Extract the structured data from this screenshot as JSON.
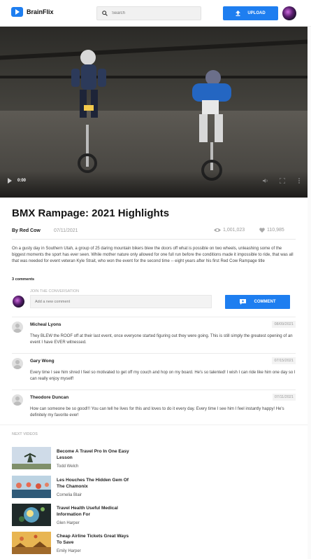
{
  "header": {
    "logo_text": "BrainFlix",
    "search_placeholder": "Search",
    "upload_label": "UPLOAD"
  },
  "video": {
    "time": "0:00",
    "title": "BMX Rampage: 2021 Highlights",
    "channel": "By Red Cow",
    "date": "07/11/2021",
    "views": "1,001,023",
    "likes": "110,985",
    "description": "On a gusty day in Southern Utah, a group of 25 daring mountain bikers blew the doors off what is possible on two wheels, unleashing some of the biggest moments the sport has ever seen. While mother nature only allowed for one full run before the conditions made it impossible to ride, that was all that was needed for event veteran Kyle Strait, who won the event for the second time -- eight years after his first Red Cow Rampage title"
  },
  "comments_section": {
    "count": "3 comments",
    "join_label": "JOIN THE CONVERSATION",
    "input_placeholder": "Add a new comment",
    "button_label": "COMMENT",
    "comments": [
      {
        "name": "Micheal Lyons",
        "date": "08/09/2021",
        "text": "They BLEW the ROOF off at their last event, once everyone started figuring out they were going. This is still simply the greatest opening of an event I have EVER witnessed."
      },
      {
        "name": "Gary Wong",
        "date": "07/15/2021",
        "text": "Every time I see him shred I feel so motivated to get off my couch and hop on my board. He's so talented! I wish I can ride like him one day so I can really enjoy myself!"
      },
      {
        "name": "Theodore Duncan",
        "date": "07/11/2021",
        "text": "How can someone be so good!!! You can tell he lives for this and loves to do it every day. Every time I see him I feel instantly happy! He's definitely my favorite ever!"
      }
    ]
  },
  "next_videos": {
    "heading": "NEXT VIDEOS",
    "items": [
      {
        "title": "Become A Travel Pro In One Easy Lesson",
        "author": "Todd Welch"
      },
      {
        "title": "Les Houches The Hidden Gem Of The Chamonix",
        "author": "Cornelia Blair"
      },
      {
        "title": "Travel Health Useful Medical Information For",
        "author": "Glen Harper"
      },
      {
        "title": "Cheap Airline Tickets Great Ways To Save",
        "author": "Emily Harper"
      }
    ]
  },
  "colors": {
    "accent": "#1e7ef0"
  }
}
